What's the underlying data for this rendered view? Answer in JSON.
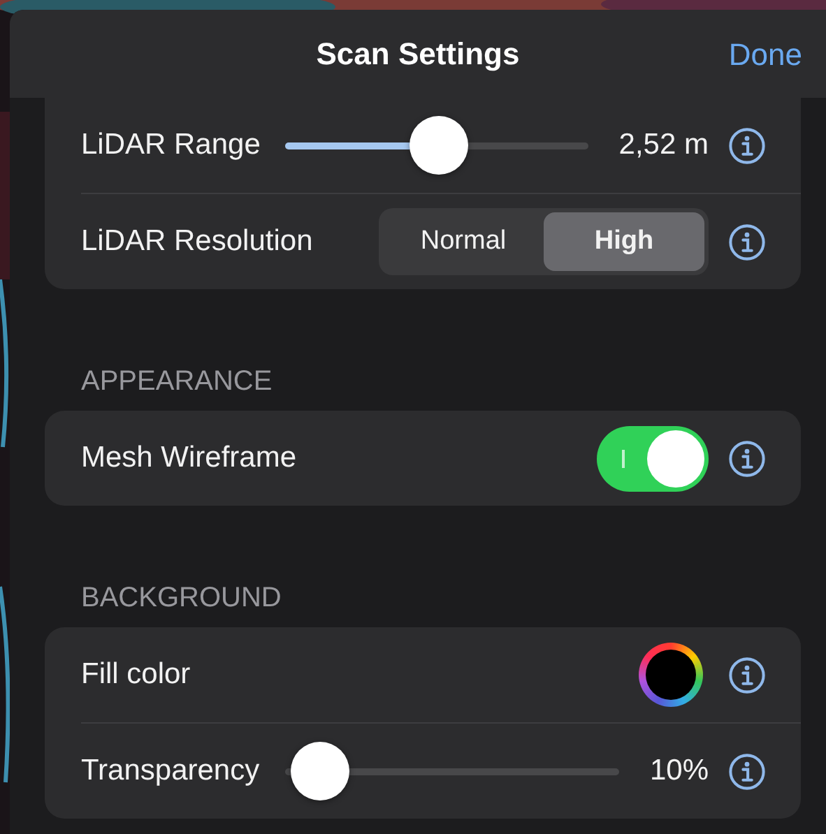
{
  "header": {
    "title": "Scan Settings",
    "done": "Done"
  },
  "sections": [
    {
      "rows": [
        {
          "kind": "slider",
          "label": "LiDAR Range",
          "level": 0.51,
          "reading": "2,52 m"
        },
        {
          "kind": "segmented",
          "label": "LiDAR Resolution",
          "options": [
            {
              "label": "Normal",
              "selected": false
            },
            {
              "label": "High",
              "selected": true
            }
          ]
        }
      ]
    },
    {
      "heading": "APPEARANCE",
      "rows": [
        {
          "kind": "toggle",
          "label": "Mesh Wireframe",
          "on": true
        }
      ]
    },
    {
      "heading": "BACKGROUND",
      "rows": [
        {
          "kind": "color",
          "label": "Fill color",
          "color": "#000000"
        },
        {
          "kind": "slider",
          "label": "Transparency",
          "level": 0.02,
          "reading": "10%"
        }
      ]
    }
  ]
}
